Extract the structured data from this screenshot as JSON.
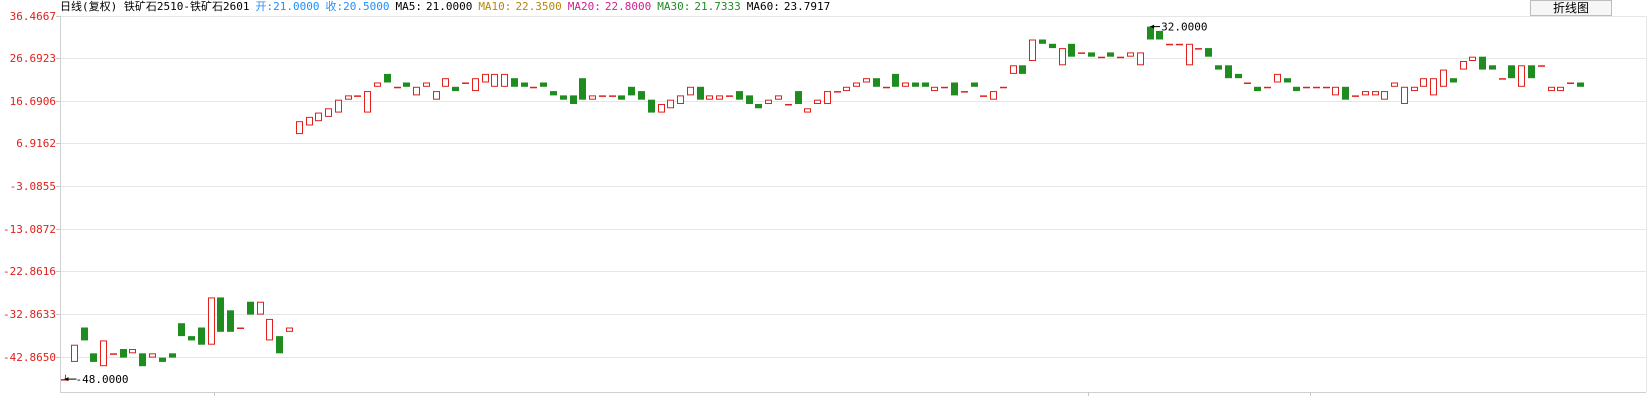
{
  "header": {
    "name": "日线(复权) 铁矿石2510-铁矿石2601",
    "open_label": "开:",
    "open_value": "21.0000",
    "close_label": "收:",
    "close_value": "20.5000",
    "ma5_label": "MA5:",
    "ma5_value": "21.0000",
    "ma10_label": "MA10:",
    "ma10_value": "22.3500",
    "ma20_label": "MA20:",
    "ma20_value": "22.8000",
    "ma30_label": "MA30:",
    "ma30_value": "21.7333",
    "ma60_label": "MA60:",
    "ma60_value": "23.7917"
  },
  "toolbar": {
    "line_chart_button": "折线图"
  },
  "colors": {
    "up": "#e0201c",
    "down": "#1e8c1e",
    "axis_text": "#e0201c",
    "grid": "#e6e6e6"
  },
  "chart_data": {
    "type": "candlestick",
    "y_ticks": [
      "36.4667",
      "26.6923",
      "16.6906",
      "6.9162",
      "-3.0855",
      "-13.0872",
      "-22.8616",
      "-32.8633",
      "-42.8650"
    ],
    "ylim": [
      -51,
      36.4667
    ],
    "grid": true,
    "annotations": {
      "max": "32.0000",
      "min": "-48.0000"
    },
    "candles": [
      [
        -48,
        -48,
        -48,
        -47
      ],
      [
        -44,
        -40,
        -44,
        -40
      ],
      [
        -36,
        -39,
        -39,
        -36
      ],
      [
        -42,
        -44,
        -44,
        -42
      ],
      [
        -45,
        -39,
        -45,
        -39
      ],
      [
        -42,
        -42,
        -42,
        -42
      ],
      [
        -41,
        -43,
        -43,
        -41
      ],
      [
        -42,
        -41,
        -42,
        -41
      ],
      [
        -42,
        -45,
        -45,
        -42
      ],
      [
        -43,
        -42,
        -43,
        -42
      ],
      [
        -43,
        -44,
        -44,
        -43
      ],
      [
        -42,
        -43,
        -43,
        -42
      ],
      [
        -35,
        -38,
        -38,
        -35
      ],
      [
        -38,
        -39,
        -39,
        -38
      ],
      [
        -36,
        -40,
        -40,
        -36
      ],
      [
        -40,
        -29,
        -40,
        -29
      ],
      [
        -29,
        -37,
        -37,
        -29
      ],
      [
        -32,
        -37,
        -37,
        -32
      ],
      [
        -36,
        -36,
        -36,
        -36
      ],
      [
        -30,
        -33,
        -33,
        -30
      ],
      [
        -33,
        -30,
        -33,
        -30
      ],
      [
        -39,
        -34,
        -39,
        -34
      ],
      [
        -38,
        -42,
        -42,
        -38
      ],
      [
        -37,
        -36,
        -37,
        -36
      ],
      [
        9,
        12,
        9,
        12
      ],
      [
        11,
        13,
        11,
        13
      ],
      [
        12,
        14,
        12,
        14
      ],
      [
        13,
        15,
        13,
        15
      ],
      [
        14,
        17,
        14,
        17
      ],
      [
        17,
        18,
        17,
        18
      ],
      [
        18,
        18,
        18,
        18
      ],
      [
        14,
        19,
        14,
        19
      ],
      [
        20,
        21,
        20,
        21
      ],
      [
        23,
        21,
        21,
        23
      ],
      [
        20,
        20,
        20,
        20
      ],
      [
        21,
        20,
        20,
        21
      ],
      [
        18,
        20,
        18,
        20
      ],
      [
        20,
        21,
        20,
        21
      ],
      [
        17,
        19,
        17,
        19
      ],
      [
        20,
        22,
        20,
        22
      ],
      [
        20,
        19,
        19,
        20
      ],
      [
        21,
        21,
        21,
        21
      ],
      [
        19,
        22,
        19,
        22
      ],
      [
        21,
        23,
        21,
        23
      ],
      [
        20,
        23,
        20,
        23
      ],
      [
        20,
        23,
        20,
        23
      ],
      [
        22,
        20,
        20,
        22
      ],
      [
        21,
        20,
        20,
        21
      ],
      [
        20,
        20,
        20,
        20
      ],
      [
        21,
        20,
        20,
        21
      ],
      [
        19,
        18,
        18,
        19
      ],
      [
        18,
        17,
        17,
        18
      ],
      [
        18,
        16,
        16,
        18
      ],
      [
        22,
        17,
        17,
        22
      ],
      [
        17,
        18,
        17,
        18
      ],
      [
        18,
        18,
        18,
        18
      ],
      [
        18,
        18,
        18,
        18
      ],
      [
        18,
        17,
        17,
        18
      ],
      [
        20,
        18,
        18,
        20
      ],
      [
        19,
        17,
        17,
        19
      ],
      [
        17,
        14,
        14,
        17
      ],
      [
        14,
        16,
        14,
        16
      ],
      [
        15,
        17,
        15,
        17
      ],
      [
        16,
        18,
        16,
        18
      ],
      [
        18,
        20,
        18,
        20
      ],
      [
        20,
        17,
        17,
        20
      ],
      [
        17,
        18,
        17,
        18
      ],
      [
        17,
        18,
        17,
        18
      ],
      [
        18,
        18,
        18,
        18
      ],
      [
        19,
        17,
        17,
        19
      ],
      [
        18,
        16,
        16,
        18
      ],
      [
        16,
        15,
        15,
        16
      ],
      [
        16,
        17,
        16,
        17
      ],
      [
        17,
        18,
        17,
        18
      ],
      [
        16,
        16,
        16,
        16
      ],
      [
        19,
        16,
        16,
        19
      ],
      [
        14,
        15,
        14,
        15
      ],
      [
        16,
        17,
        16,
        17
      ],
      [
        16,
        19,
        16,
        19
      ],
      [
        19,
        19,
        19,
        19
      ],
      [
        19,
        20,
        19,
        20
      ],
      [
        20,
        21,
        20,
        21
      ],
      [
        21,
        22,
        21,
        22
      ],
      [
        22,
        20,
        20,
        22
      ],
      [
        20,
        20,
        20,
        20
      ],
      [
        23,
        20,
        20,
        23
      ],
      [
        20,
        21,
        20,
        21
      ],
      [
        21,
        20,
        20,
        21
      ],
      [
        21,
        20,
        20,
        21
      ],
      [
        19,
        20,
        19,
        20
      ],
      [
        20,
        20,
        20,
        20
      ],
      [
        21,
        18,
        18,
        21
      ],
      [
        19,
        19,
        19,
        19
      ],
      [
        21,
        20,
        20,
        21
      ],
      [
        18,
        18,
        18,
        18
      ],
      [
        17,
        19,
        17,
        19
      ],
      [
        20,
        20,
        20,
        20
      ],
      [
        23,
        25,
        23,
        25
      ],
      [
        25,
        23,
        23,
        25
      ],
      [
        26,
        31,
        26,
        31
      ],
      [
        31,
        30,
        30,
        31
      ],
      [
        30,
        29,
        29,
        30
      ],
      [
        25,
        29,
        25,
        29
      ],
      [
        30,
        27,
        27,
        30
      ],
      [
        28,
        28,
        28,
        28
      ],
      [
        28,
        27,
        27,
        28
      ],
      [
        27,
        27,
        27,
        27
      ],
      [
        28,
        27,
        27,
        28
      ],
      [
        27,
        27,
        27,
        27
      ],
      [
        27,
        28,
        27,
        28
      ],
      [
        25,
        28,
        25,
        28
      ],
      [
        34,
        31,
        31,
        34
      ],
      [
        33,
        31,
        31,
        33
      ],
      [
        30,
        30,
        30,
        30
      ],
      [
        30,
        30,
        30,
        30
      ],
      [
        25,
        30,
        25,
        30
      ],
      [
        29,
        29,
        29,
        29
      ],
      [
        29,
        27,
        27,
        29
      ],
      [
        25,
        24,
        24,
        25
      ],
      [
        25,
        22,
        22,
        25
      ],
      [
        23,
        22,
        22,
        23
      ],
      [
        21,
        21,
        21,
        21
      ],
      [
        20,
        19,
        19,
        20
      ],
      [
        20,
        20,
        20,
        20
      ],
      [
        21,
        23,
        21,
        23
      ],
      [
        22,
        21,
        21,
        22
      ],
      [
        20,
        19,
        19,
        20
      ],
      [
        20,
        20,
        20,
        20
      ],
      [
        20,
        20,
        20,
        20
      ],
      [
        20,
        20,
        20,
        20
      ],
      [
        18,
        20,
        18,
        20
      ],
      [
        20,
        17,
        17,
        20
      ],
      [
        18,
        18,
        18,
        18
      ],
      [
        18,
        19,
        18,
        19
      ],
      [
        18,
        19,
        18,
        19
      ],
      [
        17,
        19,
        17,
        19
      ],
      [
        20,
        21,
        20,
        21
      ],
      [
        16,
        20,
        16,
        20
      ],
      [
        19,
        20,
        19,
        20
      ],
      [
        20,
        22,
        20,
        22
      ],
      [
        18,
        22,
        18,
        22
      ],
      [
        20,
        24,
        20,
        24
      ],
      [
        22,
        21,
        21,
        22
      ],
      [
        24,
        26,
        24,
        26
      ],
      [
        26,
        27,
        26,
        27
      ],
      [
        27,
        24,
        24,
        27
      ],
      [
        25,
        24,
        24,
        25
      ],
      [
        22,
        22,
        22,
        22
      ],
      [
        25,
        22,
        22,
        25
      ],
      [
        20,
        25,
        20,
        25
      ],
      [
        25,
        22,
        22,
        25
      ],
      [
        25,
        25,
        25,
        25
      ],
      [
        19,
        20,
        19,
        20
      ],
      [
        19,
        20,
        19,
        20
      ],
      [
        21,
        21,
        21,
        21
      ],
      [
        21,
        20,
        20,
        21
      ]
    ]
  }
}
